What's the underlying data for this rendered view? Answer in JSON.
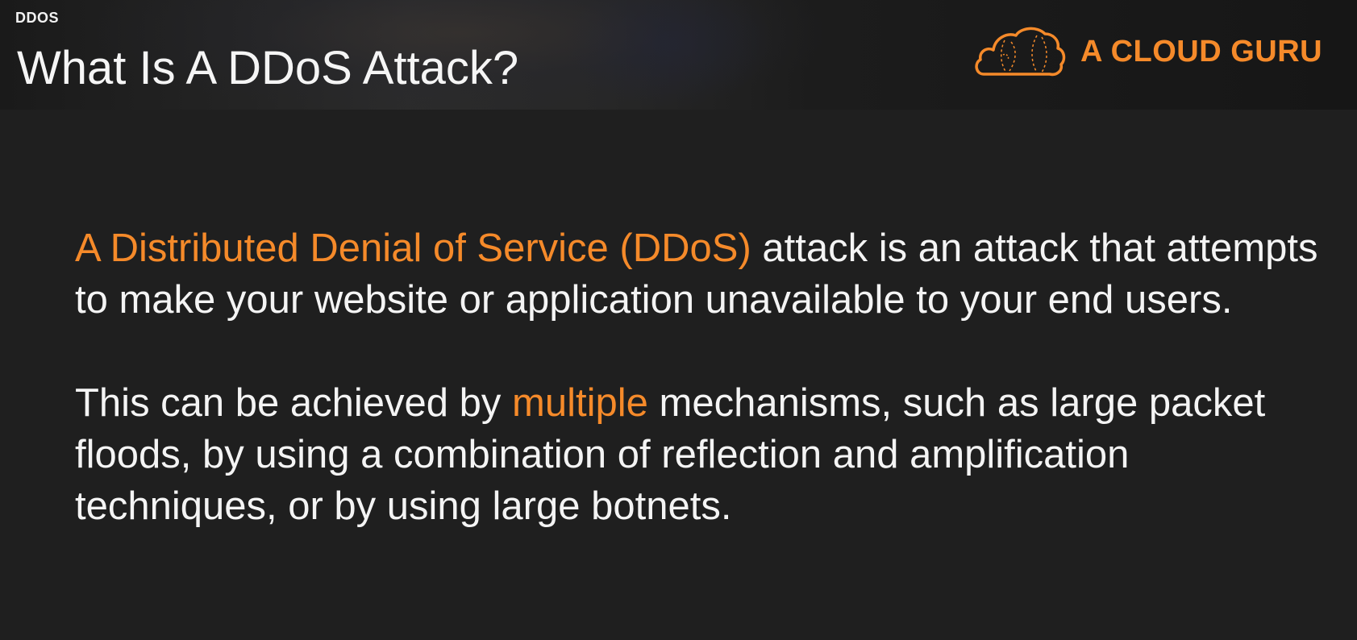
{
  "header": {
    "section_label": "DDOS",
    "title": "What Is A DDoS Attack?",
    "logo_text": "A CLOUD GURU"
  },
  "content": {
    "paragraph1": {
      "highlight": "A Distributed Denial of Service (DDoS)",
      "rest": " attack is an attack that attempts to make your website or application unavailable to your end users."
    },
    "paragraph2": {
      "before": "This can be achieved by ",
      "highlight": "multiple",
      "after": " mechanisms, such as large packet floods, by using a combination of reflection and amplification techniques, or by using large botnets."
    }
  },
  "colors": {
    "accent": "#f58a2a",
    "background": "#1f1f1f",
    "text": "#f4f4f4"
  },
  "icons": {
    "logo": "cloud-logo-icon"
  }
}
